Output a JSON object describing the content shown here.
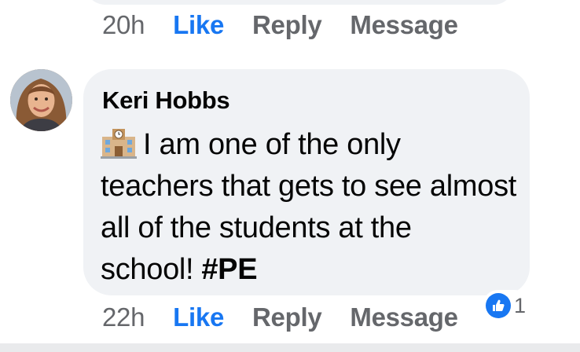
{
  "previous_comment": {
    "time": "20h",
    "like": "Like",
    "reply": "Reply",
    "message": "Message"
  },
  "comment": {
    "author": "Keri Hobbs",
    "text_line": "I am one of the only teachers that gets to see almost all of the students at the school!",
    "hashtag": "#PE",
    "leading_emoji_icon": "school-icon",
    "time": "22h",
    "like": "Like",
    "reply": "Reply",
    "message": "Message",
    "reaction_icon": "thumbs-up-icon",
    "reaction_count": "1"
  },
  "colors": {
    "bubble": "#f0f2f5",
    "like_blue": "#1877f2",
    "secondary_text": "#65676b",
    "primary_text": "#050505"
  }
}
